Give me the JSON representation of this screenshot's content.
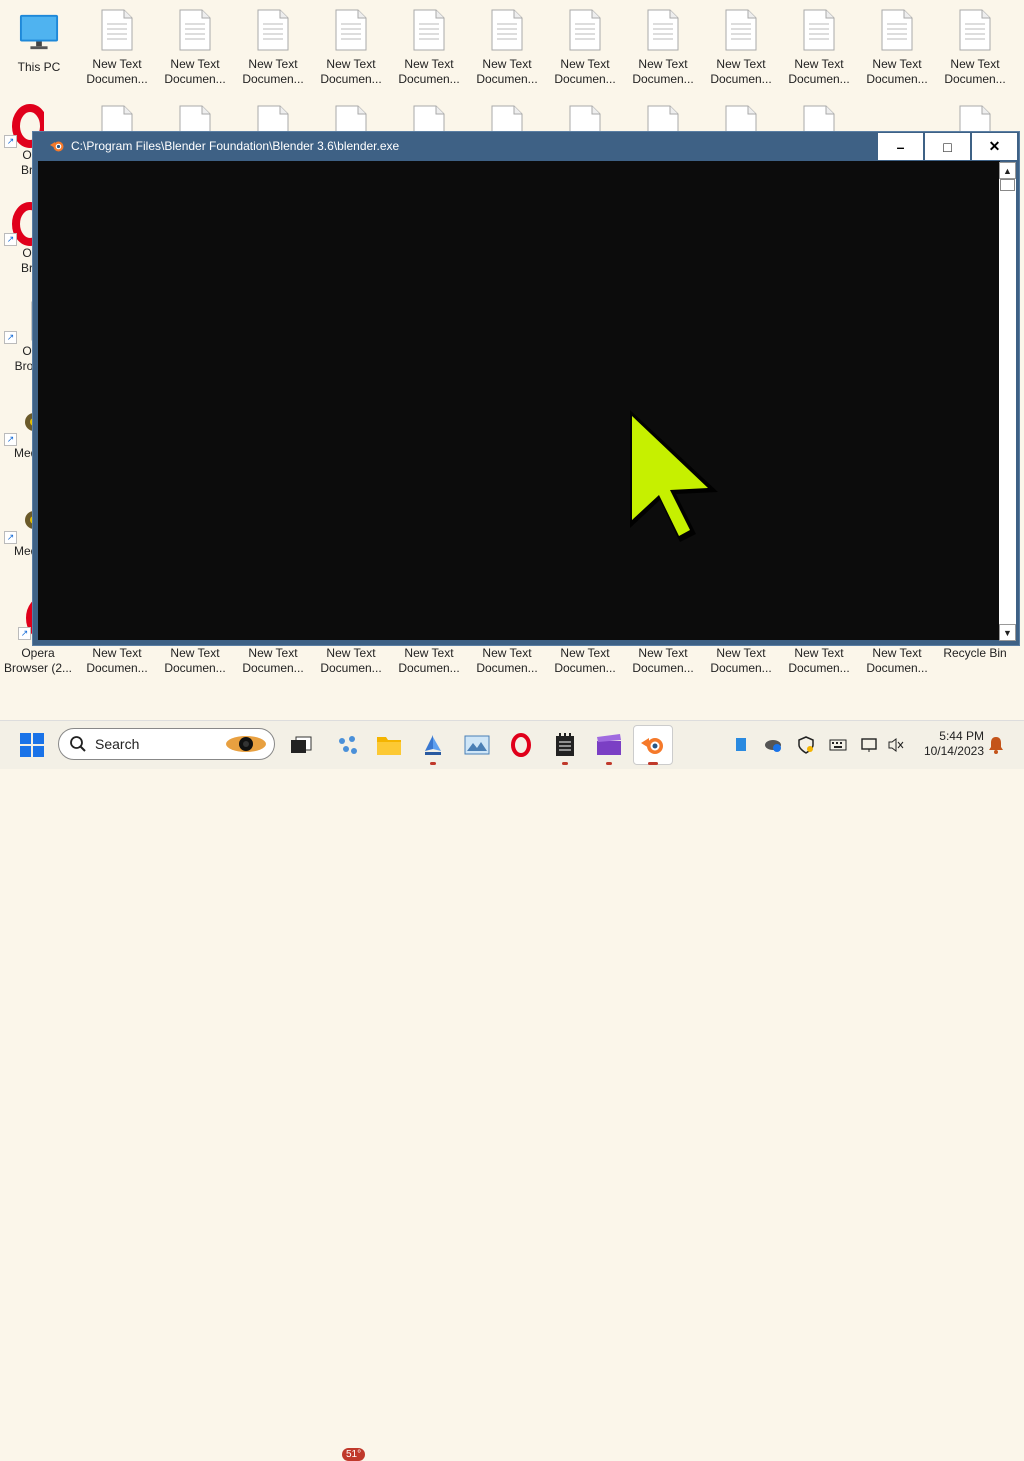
{
  "desktop": {
    "this_pc_label": "This PC",
    "doc_label": "New Text Documen...",
    "doc_line1": "New Text",
    "doc_line2": "Documen...",
    "left_icons": [
      {
        "line1": "O",
        "line2": "Br"
      },
      {
        "line1": "O",
        "line2": "Br"
      },
      {
        "line1": "O",
        "line2": "Brov"
      },
      {
        "line1": "Medi",
        "line2": ""
      },
      {
        "line1": "Medi",
        "line2": ""
      }
    ],
    "bottom_row": {
      "opera_line1": "Opera",
      "opera_line2": "Browser (2...",
      "recycle_label": "Recycle Bin"
    }
  },
  "window": {
    "title": "C:\\Program Files\\Blender Foundation\\Blender 3.6\\blender.exe",
    "minimize": "–",
    "maximize": "□",
    "close": "✕"
  },
  "taskbar": {
    "search_label": "Search",
    "weather_badge": "51°",
    "time": "5:44 PM",
    "date": "10/14/2023"
  },
  "colors": {
    "cursor": "#c6f000",
    "titlebar": "#3e6185",
    "console_bg": "#0c0c0c"
  }
}
